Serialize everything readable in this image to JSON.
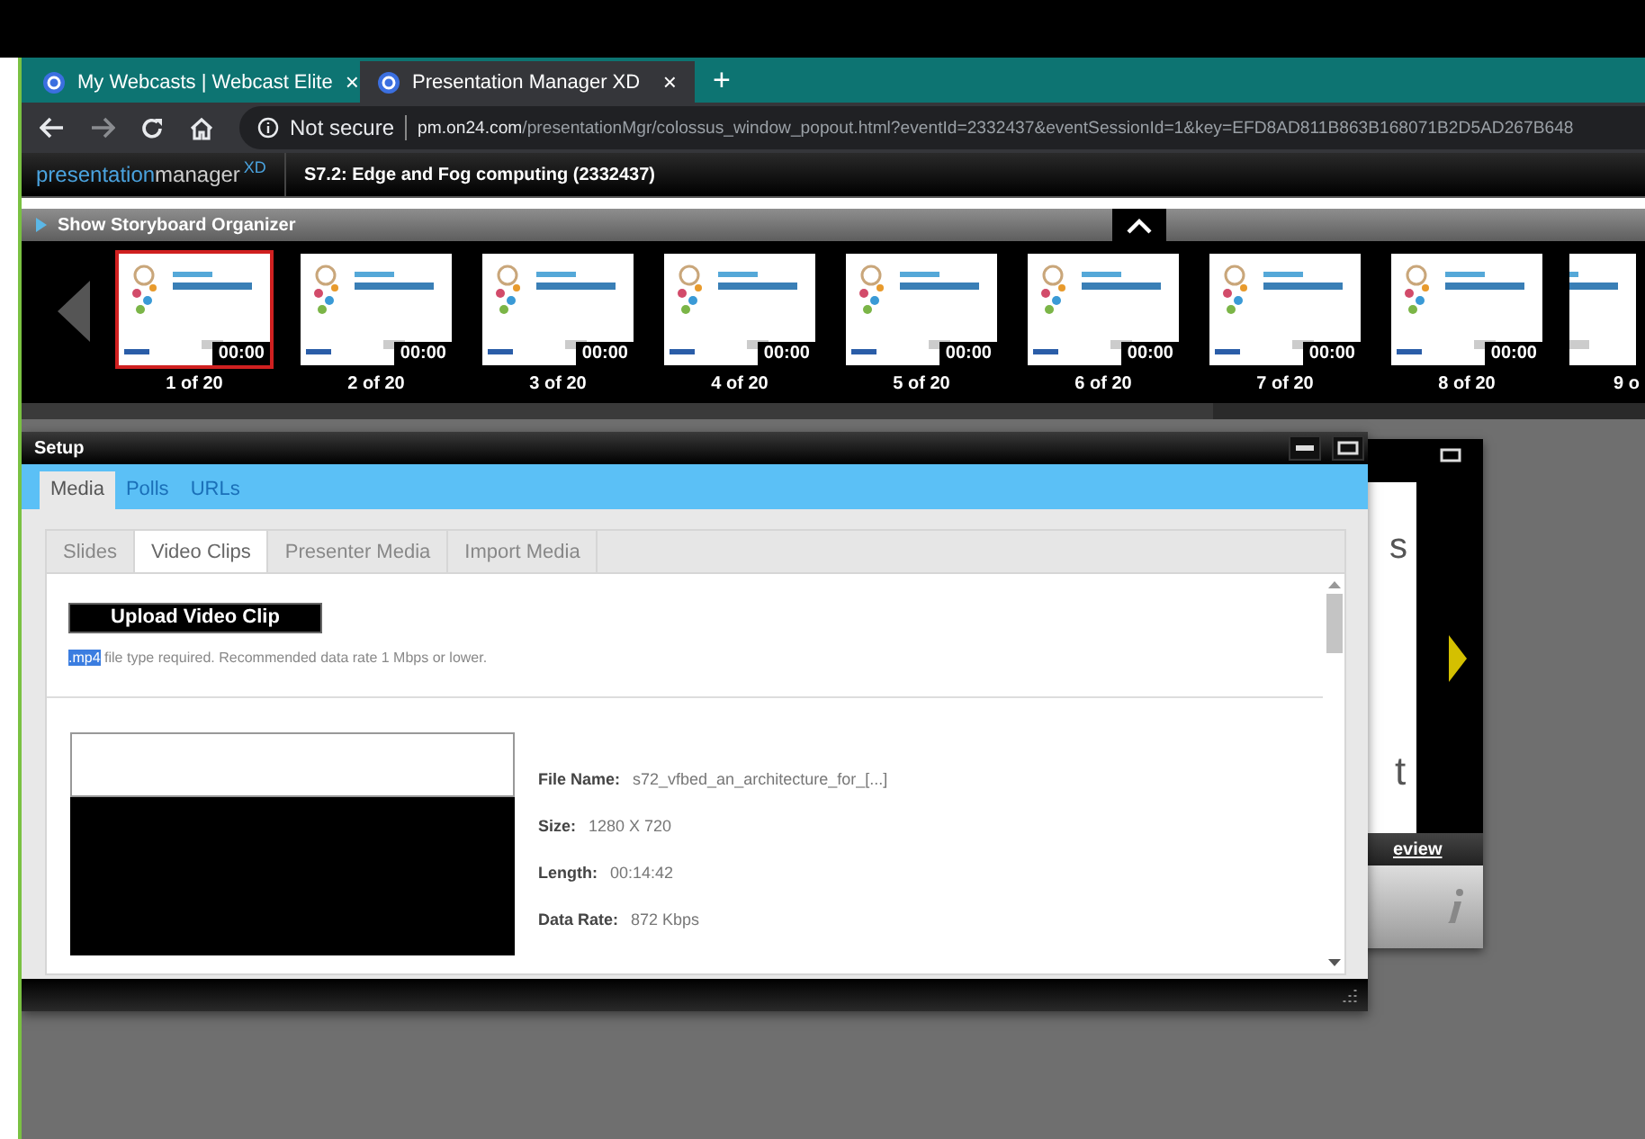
{
  "browser": {
    "tabs": [
      {
        "title": "My Webcasts | Webcast Elite",
        "close": "×",
        "selected": false
      },
      {
        "title": "Presentation Manager XD",
        "close": "×",
        "selected": true
      }
    ],
    "new_tab": "+",
    "security": "Not secure",
    "url_host": "pm.on24.com",
    "url_path": "/presentationMgr/colossus_window_popout.html?eventId=2332437&eventSessionId=1&key=EFD8AD811B863B168071B2D5AD267B648"
  },
  "app": {
    "logo_light": "presentation",
    "logo_bold": "manager",
    "logo_sup": "XD",
    "event_title": "S7.2: Edge and Fog computing (2332437)"
  },
  "storyboard": {
    "toggle_label": "Show Storyboard Organizer",
    "slides": [
      {
        "time": "00:00",
        "label": "1 of 20",
        "selected": true
      },
      {
        "time": "00:00",
        "label": "2 of 20",
        "selected": false
      },
      {
        "time": "00:00",
        "label": "3 of 20",
        "selected": false
      },
      {
        "time": "00:00",
        "label": "4 of 20",
        "selected": false
      },
      {
        "time": "00:00",
        "label": "5 of 20",
        "selected": false
      },
      {
        "time": "00:00",
        "label": "6 of 20",
        "selected": false
      },
      {
        "time": "00:00",
        "label": "7 of 20",
        "selected": false
      },
      {
        "time": "00:00",
        "label": "8 of 20",
        "selected": false
      },
      {
        "label": "9 o",
        "selected": false
      }
    ]
  },
  "setup": {
    "title": "Setup",
    "tabs": [
      {
        "label": "Media",
        "selected": true
      },
      {
        "label": "Polls",
        "selected": false
      },
      {
        "label": "URLs",
        "selected": false
      }
    ],
    "subtabs": [
      {
        "label": "Slides",
        "selected": false
      },
      {
        "label": "Video Clips",
        "selected": true
      },
      {
        "label": "Presenter Media",
        "selected": false
      },
      {
        "label": "Import Media",
        "selected": false
      }
    ],
    "upload_button": "Upload Video Clip",
    "note_highlight": ".mp4",
    "note": " file type required. Recommended data rate 1 Mbps or lower.",
    "fields": [
      {
        "label": "File Name:",
        "value": "s72_vfbed_an_architecture_for_[...]"
      },
      {
        "label": "Size:",
        "value": "1280 X 720"
      },
      {
        "label": "Length:",
        "value": "00:14:42"
      },
      {
        "label": "Data Rate:",
        "value": "872 Kbps"
      }
    ]
  },
  "back_window": {
    "fragment_1": "s",
    "fragment_2": "t",
    "link": "eview"
  }
}
